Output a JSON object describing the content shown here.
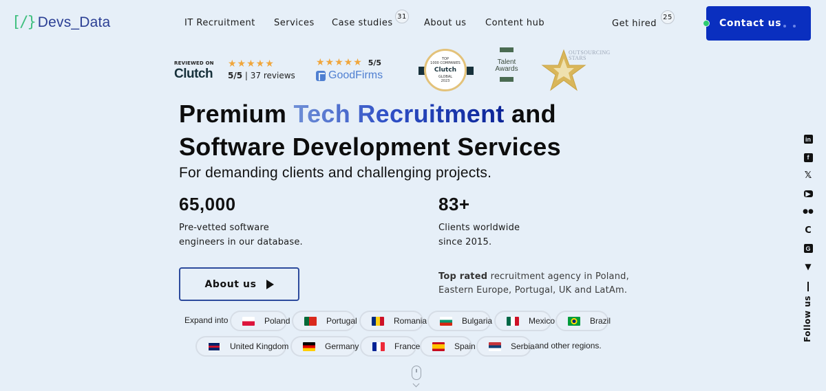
{
  "header": {
    "logo_mark": "[/}",
    "logo_text": "Devs_Data",
    "nav": [
      {
        "label": "IT Recruitment"
      },
      {
        "label": "Services"
      },
      {
        "label": "Case studies",
        "badge": "31"
      },
      {
        "label": "About us"
      },
      {
        "label": "Content hub"
      }
    ],
    "get_hired": {
      "label": "Get hired",
      "badge": "25"
    },
    "contact_label": "Contact us"
  },
  "reviews": {
    "clutch": {
      "reviewed_on": "REVIEWED ON",
      "brand": "Clutch",
      "stars": "★★★★★",
      "score": "5/5",
      "count_text": "| 37 reviews"
    },
    "goodfirms": {
      "stars": "★★★★★",
      "score": "5/5",
      "brand": "GoodFirms"
    },
    "awards": {
      "clutch_top": {
        "line1": "TOP",
        "line2": "1000 COMPANIES",
        "brand": "Clutch",
        "line3": "GLOBAL",
        "year": "2023"
      },
      "talent": {
        "line1": "Talent",
        "line2": "Awards"
      },
      "outsourcing": {
        "line1": "OUTSOURCING",
        "line2": "STARS"
      }
    }
  },
  "hero": {
    "title_part1": "Premium ",
    "title_highlight": "Tech Recruitment",
    "title_part2": " and",
    "title_bold": "Software Development",
    "title_part3": " Services",
    "subtitle": "For demanding clients and challenging projects.",
    "stats": [
      {
        "value": "65,000",
        "line1": "Pre-vetted software",
        "line2": "engineers in our database."
      },
      {
        "value": "83+",
        "line1": "Clients worldwide",
        "line2": "since 2015."
      }
    ],
    "about_button": "About us",
    "top_rated_bold": "Top rated",
    "top_rated_line1": " recruitment agency in Poland,",
    "top_rated_line2": "Eastern Europe, Portugal, UK and LatAm."
  },
  "countries": {
    "label": "Expand into",
    "items": [
      {
        "name": "Poland"
      },
      {
        "name": "Portugal"
      },
      {
        "name": "Romania"
      },
      {
        "name": "Bulgaria"
      },
      {
        "name": "Mexico"
      },
      {
        "name": "Brazil"
      },
      {
        "name": "United Kingdom"
      },
      {
        "name": "Germany"
      },
      {
        "name": "France"
      },
      {
        "name": "Spain"
      },
      {
        "name": "Serbia"
      }
    ],
    "other": "and other regions."
  },
  "social": {
    "icons": [
      "linkedin-icon",
      "facebook-icon",
      "x-icon",
      "youtube-icon",
      "medium-icon",
      "clutch-icon",
      "goodfirms-icon",
      "vue-icon"
    ],
    "follow_label": "Follow us"
  },
  "colors": {
    "background": "#e6eff8",
    "accent": "#0a2fbf",
    "online_dot": "#2ecc71",
    "star": "#f0a63c",
    "logo_green": "#3fbf7f",
    "logo_blue": "#2b3f94"
  }
}
